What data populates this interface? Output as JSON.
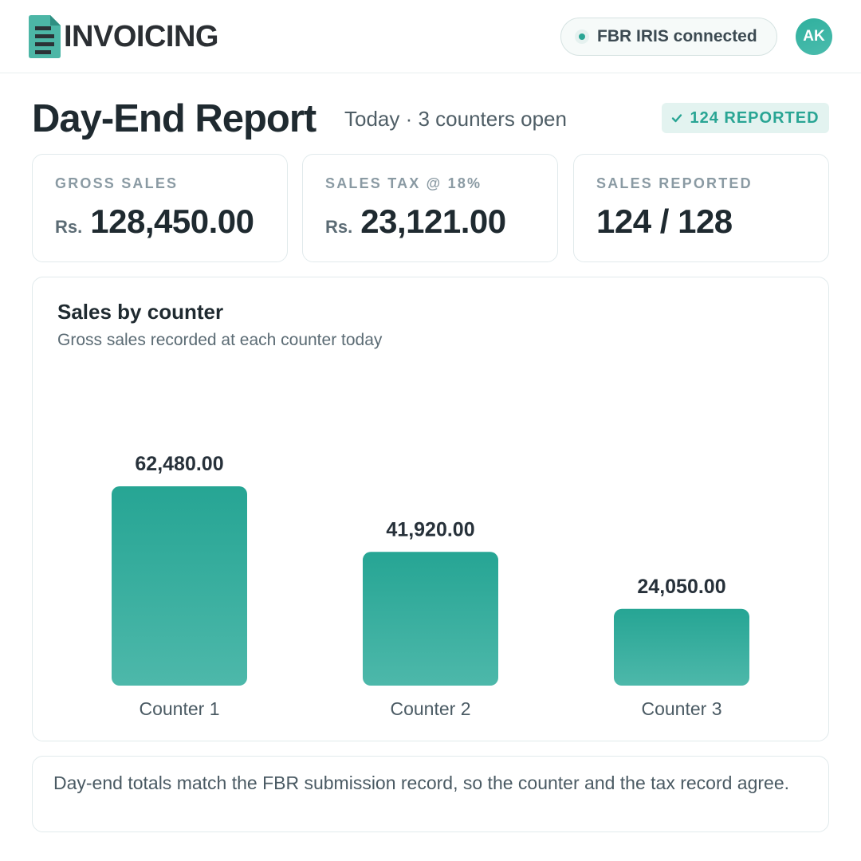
{
  "header": {
    "app_name": "INVOICING",
    "logo_icon": "invoice-document-icon",
    "status": {
      "text": "FBR IRIS connected",
      "state_color": "#29a594"
    },
    "avatar_initials": "AK"
  },
  "page": {
    "title": "Day-End Report",
    "subtitle": "Today · 3 counters open",
    "badge": {
      "icon": "check-icon",
      "text": "124 REPORTED"
    }
  },
  "stats": [
    {
      "label": "GROSS SALES",
      "currency": "Rs.",
      "value": "128,450.00"
    },
    {
      "label": "SALES TAX @ 18%",
      "currency": "Rs.",
      "value": "23,121.00"
    },
    {
      "label": "SALES REPORTED",
      "currency": "",
      "value": "124 / 128"
    }
  ],
  "chart_card": {
    "title": "Sales by counter",
    "subtitle": "Gross sales recorded at each counter today"
  },
  "chart_data": {
    "type": "bar",
    "title": "Sales by counter",
    "subtitle": "Gross sales recorded at each counter today",
    "categories": [
      "Counter 1",
      "Counter 2",
      "Counter 3"
    ],
    "values": [
      62480,
      41920,
      24050
    ],
    "value_labels": [
      "62,480.00",
      "41,920.00",
      "24,050.00"
    ],
    "ylim": [
      0,
      62480
    ],
    "grid": false,
    "legend": "none",
    "colors": {
      "bar_top": "#26a594",
      "bar_bottom": "#4db8aa"
    }
  },
  "footer": {
    "note": "Day-end totals match the FBR submission record, so the counter and the tax record agree."
  },
  "colors": {
    "accent": "#29a594",
    "badge_bg": "#e3f3f0",
    "text_primary": "#1f2a30",
    "text_muted": "#8a9aa3",
    "card_border": "#e1eaec"
  }
}
